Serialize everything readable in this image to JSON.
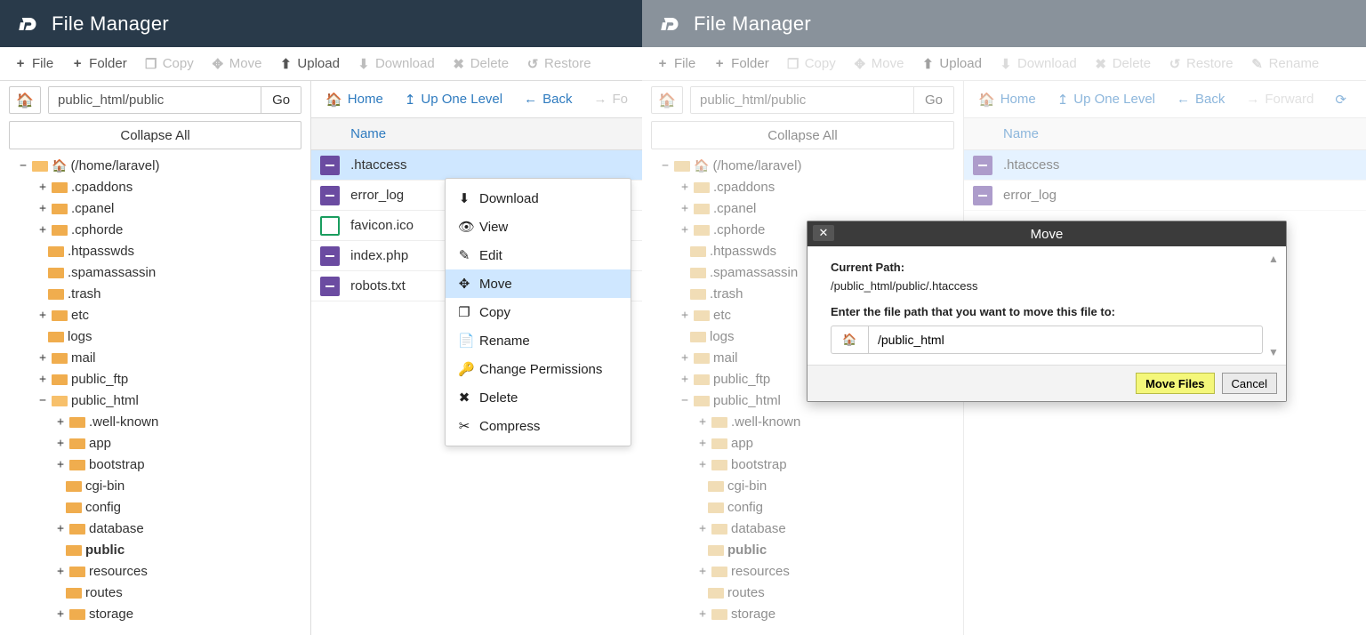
{
  "app_title": "File Manager",
  "toolbar": {
    "file": "File",
    "folder": "Folder",
    "copy": "Copy",
    "move": "Move",
    "upload": "Upload",
    "download": "Download",
    "delete": "Delete",
    "restore": "Restore",
    "rename": "Rename"
  },
  "glyph": {
    "plus": "+",
    "clone": "❐",
    "arrows": "✥",
    "upload": "⬆",
    "download": "⬇",
    "x": "✖",
    "undo": "↺",
    "edit": "✎",
    "home": "🏠",
    "up": "↥",
    "back": "←",
    "forward": "→",
    "reload": "⟳",
    "eye": "👁",
    "key": "🔑",
    "doc": "📄",
    "compress": "✂"
  },
  "pathbar": {
    "value": "public_html/public",
    "go": "Go"
  },
  "collapse_all": "Collapse All",
  "tree": {
    "root": "(/home/laravel)",
    "items": [
      ".cpaddons",
      ".cpanel",
      ".cphorde",
      ".htpasswds",
      ".spamassassin",
      ".trash",
      "etc",
      "logs",
      "mail",
      "public_ftp",
      "public_html",
      ".well-known",
      "app",
      "bootstrap",
      "cgi-bin",
      "config",
      "database",
      "public",
      "resources",
      "routes",
      "storage"
    ]
  },
  "nav": {
    "home": "Home",
    "up": "Up One Level",
    "back": "Back",
    "forward": "Forward",
    "forward_short": "Fo"
  },
  "files": {
    "col_name": "Name",
    "left_rows": [
      ".htaccess",
      "error_log",
      "favicon.ico",
      "index.php",
      "robots.txt"
    ],
    "right_rows": [
      ".htaccess",
      "error_log"
    ]
  },
  "ctx": {
    "download": "Download",
    "view": "View",
    "edit": "Edit",
    "move": "Move",
    "copy": "Copy",
    "rename": "Rename",
    "perm": "Change Permissions",
    "delete": "Delete",
    "compress": "Compress"
  },
  "modal": {
    "title": "Move",
    "current_path_label": "Current Path:",
    "current_path": "/public_html/public/.htaccess",
    "prompt": "Enter the file path that you want to move this file to:",
    "dest": "/public_html",
    "move_btn": "Move Files",
    "cancel_btn": "Cancel"
  }
}
